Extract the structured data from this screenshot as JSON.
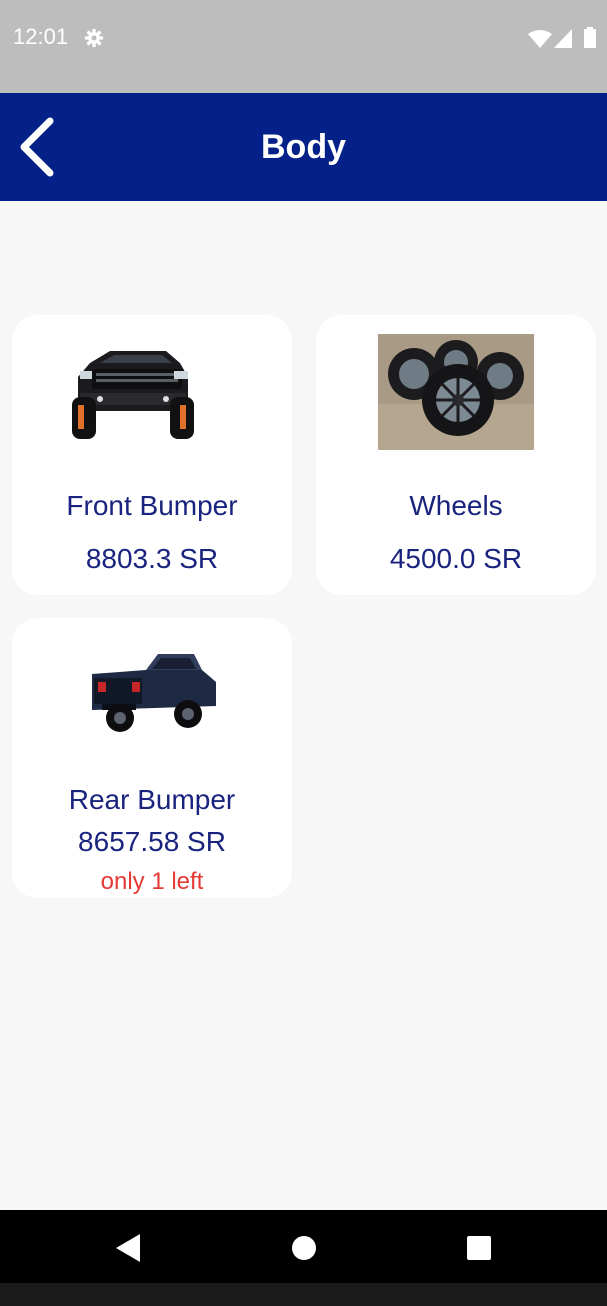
{
  "status_bar": {
    "time": "12:01",
    "icons": [
      "gear-icon",
      "wifi-icon",
      "signal-icon",
      "battery-icon"
    ]
  },
  "app_bar": {
    "title": "Body",
    "back_icon": "chevron-left-icon",
    "background_color": "#032188"
  },
  "products": [
    {
      "name": "Front Bumper",
      "price": "8803.3 SR",
      "image": "black-pickup-truck-front-view"
    },
    {
      "name": "Wheels",
      "price": "4500.0 SR",
      "image": "set-of-four-wheels-with-tires"
    },
    {
      "name": "Rear Bumper",
      "price": "8657.58 SR",
      "stock_note": "only 1 left",
      "image": "dark-blue-pickup-truck-rear-view"
    }
  ],
  "colors": {
    "text_primary": "#1a237e",
    "stock_warning": "#e53935",
    "background": "#f7f7f7"
  },
  "nav_bar": {
    "icons": [
      "back-triangle-icon",
      "home-circle-icon",
      "recents-square-icon"
    ]
  }
}
